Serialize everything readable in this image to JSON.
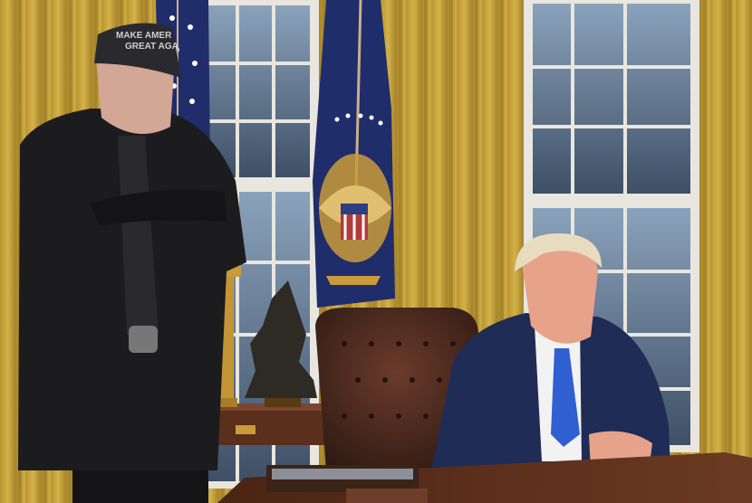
{
  "photo": {
    "cap_text_line1": "MAKE AMER",
    "cap_text_line2": "GREAT AGA"
  },
  "colors": {
    "curtain": "#c9a73c",
    "curtain_fold": "#a9862a",
    "window_frame": "#e8e6df",
    "window_glass": "#556a80",
    "flag_blue": "#1f2d6b",
    "seal_gold": "#c99b3a",
    "suit_navy": "#1f2c55",
    "tie_blue": "#2f5fd0",
    "coat_black": "#1c1c1e",
    "leather": "#4a2a20",
    "desk_wood": "#5a2f1c"
  }
}
